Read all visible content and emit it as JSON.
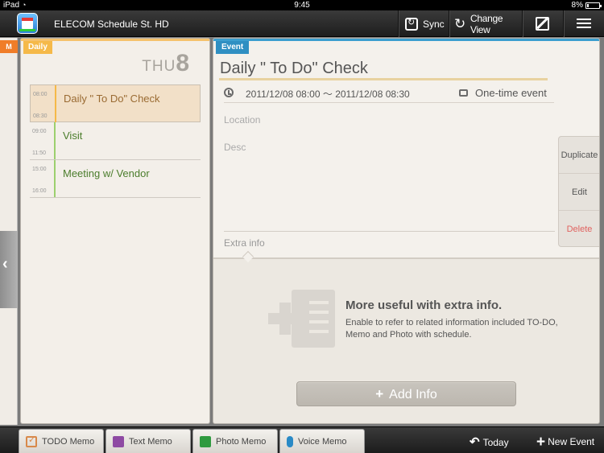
{
  "status_bar": {
    "carrier": "iPad",
    "time": "9:45",
    "battery": "8%",
    "battery_level": 0.08
  },
  "app_header": {
    "title": "ELECOM Schedule St. HD",
    "sync_label": "Sync",
    "change_view_label": "Change View"
  },
  "left_panel": {
    "tab_label": "M"
  },
  "daily": {
    "tab_label": "Daily",
    "day_of_week": "THU",
    "day_number": "8",
    "events": [
      {
        "start": "08:00",
        "end": "08:30",
        "title": "Daily \" To Do\" Check",
        "selected": true
      },
      {
        "start": "09:00",
        "end": "11:50",
        "title": "Visit",
        "selected": false
      },
      {
        "start": "15:00",
        "end": "16:00",
        "title": "Meeting w/ Vendor",
        "selected": false
      }
    ]
  },
  "event": {
    "tab_label": "Event",
    "title": "Daily \" To Do\" Check",
    "time_range": "2011/12/08 08:00 〜 2011/12/08 08:30",
    "repeat": "One-time event",
    "location_label": "Location",
    "desc_label": "Desc",
    "extra_info_label": "Extra info",
    "actions": {
      "duplicate": "Duplicate",
      "edit": "Edit",
      "delete": "Delete"
    },
    "extra_heading": "More useful with extra info.",
    "extra_text": "Enable to refer to related information included TO-DO, Memo and Photo with schedule.",
    "add_info_label": "Add Info"
  },
  "toolbar": {
    "todo_memo": "TODO Memo",
    "text_memo": "Text Memo",
    "photo_memo": "Photo Memo",
    "voice_memo": "Voice Memo",
    "today": "Today",
    "new_event": "New Event"
  },
  "colors": {
    "daily_accent": "#f5b949",
    "event_accent": "#2f8fc2",
    "delete_text": "#e0625f",
    "month_tab": "#f07d28"
  }
}
